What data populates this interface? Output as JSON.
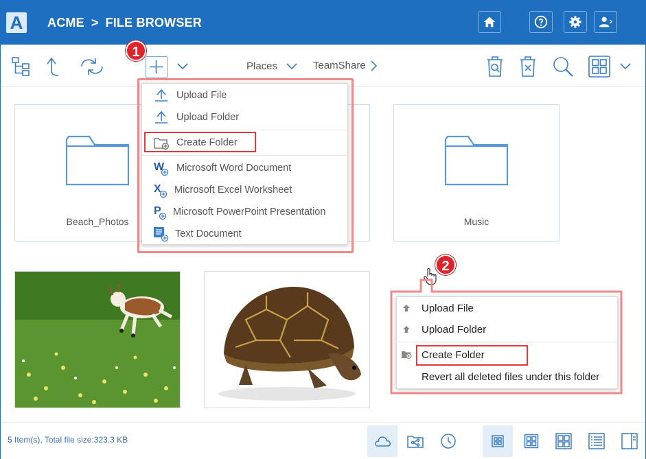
{
  "header": {
    "logo_letter": "A",
    "company": "ACME",
    "separator": ">",
    "section": "FILE BROWSER"
  },
  "toolbar": {
    "places_label": "Places",
    "teamshare_label": "TeamShare"
  },
  "new_menu": {
    "items": [
      {
        "label": "Upload File",
        "icon": "upload-icon"
      },
      {
        "label": "Upload Folder",
        "icon": "upload-icon"
      },
      {
        "label": "Create Folder",
        "icon": "folder-add-icon"
      },
      {
        "label": "Microsoft Word Document",
        "icon": "word-icon"
      },
      {
        "label": "Microsoft Excel Worksheet",
        "icon": "excel-icon"
      },
      {
        "label": "Microsoft PowerPoint Presentation",
        "icon": "powerpoint-icon"
      },
      {
        "label": "Text Document",
        "icon": "text-document-icon"
      }
    ]
  },
  "context_menu": {
    "items": [
      {
        "label": "Upload File"
      },
      {
        "label": "Upload Folder"
      },
      {
        "label": "Create Folder"
      },
      {
        "label": "Revert all deleted files under this folder"
      }
    ]
  },
  "callouts": {
    "one": "1",
    "two": "2"
  },
  "tiles": [
    {
      "name": "Beach_Photos",
      "type": "folder"
    },
    {
      "name": "",
      "type": "folder"
    },
    {
      "name": "Music",
      "type": "folder"
    }
  ],
  "photos": [
    {
      "subject": "goat"
    },
    {
      "subject": "turtle"
    }
  ],
  "footer": {
    "status": "5 Item(s), Total file size:323.3 KB"
  },
  "colors": {
    "brand": "#1e6fc0",
    "icon": "#3b7fc6",
    "highlight": "#e0393e",
    "badge": "#e0232a"
  }
}
